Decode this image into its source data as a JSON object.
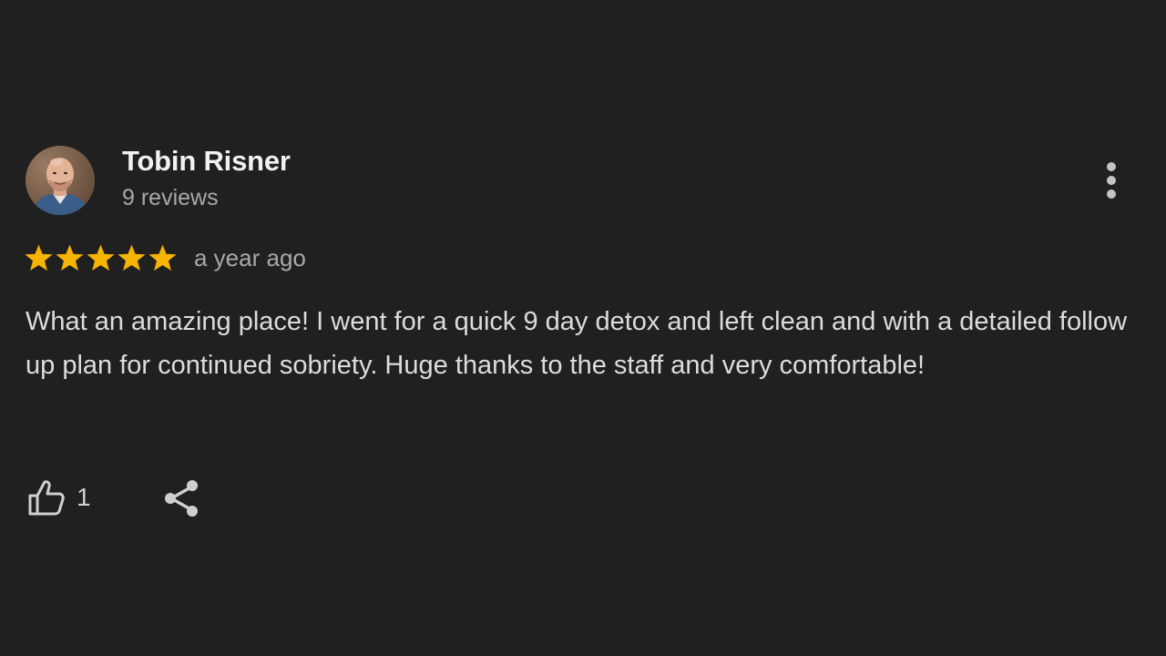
{
  "review": {
    "author": {
      "name": "Tobin Risner",
      "meta": "9 reviews",
      "avatar_icon": "user-photo-avatar"
    },
    "rating": {
      "stars": 5,
      "max": 5,
      "star_color": "#f6b400",
      "time_ago": "a year ago"
    },
    "text": "What an amazing place! I went for a quick 9 day detox and left clean and with a detailed follow up plan for continued sobriety. Huge thanks to the staff and very comfortable!",
    "actions": {
      "like_icon": "thumbs-up-icon",
      "like_count": "1",
      "share_icon": "share-icon",
      "more_icon": "more-vertical-icon"
    }
  },
  "colors": {
    "background": "#202020",
    "name": "#f1f1f1",
    "muted": "#a8a8a8",
    "body": "#dcdcdc"
  }
}
